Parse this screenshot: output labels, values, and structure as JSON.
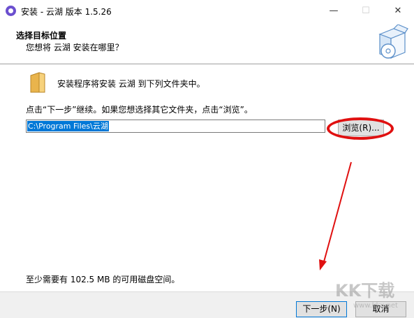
{
  "window": {
    "title": "安装 - 云湖 版本 1.5.26",
    "minimize_glyph": "—",
    "maximize_glyph": "☐",
    "close_glyph": "✕"
  },
  "header": {
    "title": "选择目标位置",
    "subtitle": "您想将 云湖 安装在哪里？",
    "icon": "install-box-icon"
  },
  "content": {
    "folder_icon": "folder-icon",
    "info": "安装程序将安装 云湖 到下列文件夹中。",
    "instruction": "点击“下一步”继续。如果您想选择其它文件夹，点击“浏览”。",
    "path_value": "C:\\Program Files\\云湖",
    "browse_label": "浏览(R)...",
    "space_required": "至少需要有 102.5 MB 的可用磁盘空间。"
  },
  "footer": {
    "next_label": "下一步(N)",
    "cancel_label": "取消"
  },
  "annotations": {
    "highlight_color": "#e01010"
  },
  "watermark": {
    "text": "KK下载",
    "url": "www.kkx.net"
  }
}
